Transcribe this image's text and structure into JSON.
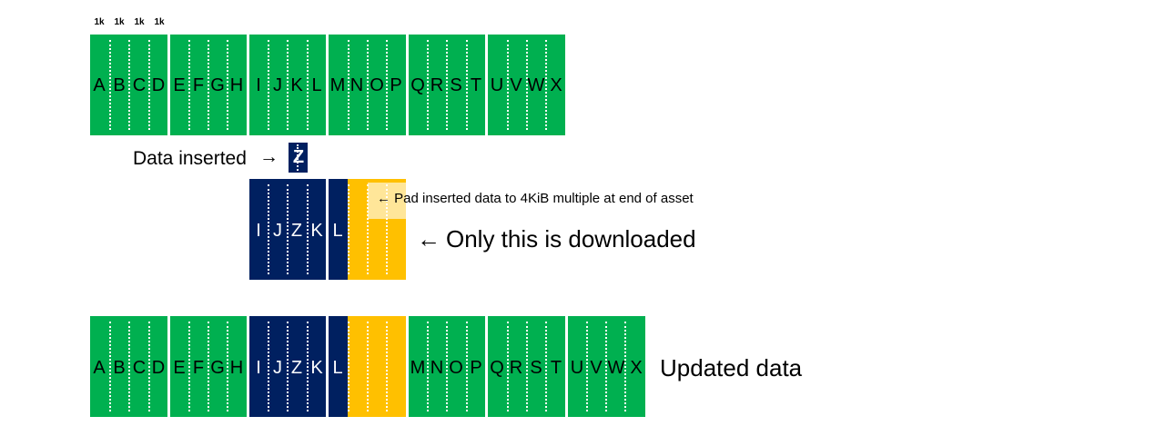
{
  "size_labels": [
    "1k",
    "1k",
    "1k",
    "1k"
  ],
  "row1": [
    "A",
    "B",
    "C",
    "D",
    "E",
    "F",
    "G",
    "H",
    "I",
    "J",
    "K",
    "L",
    "M",
    "N",
    "O",
    "P",
    "Q",
    "R",
    "S",
    "T",
    "U",
    "V",
    "W",
    "X"
  ],
  "inserted": {
    "label": "Data inserted",
    "arrow": "→",
    "value": "Z"
  },
  "row2": [
    "I",
    "J",
    "Z",
    "K",
    "L"
  ],
  "pad_note": "← Pad inserted data to 4KiB multiple at end of asset",
  "download_note": {
    "arrow": "←",
    "text": "Only this is downloaded"
  },
  "row3": [
    "A",
    "B",
    "C",
    "D",
    "E",
    "F",
    "G",
    "H",
    "I",
    "J",
    "Z",
    "K",
    "L",
    "M",
    "N",
    "O",
    "P",
    "Q",
    "R",
    "S",
    "T",
    "U",
    "V",
    "W",
    "X"
  ],
  "updated_label": "Updated data",
  "colors": {
    "green": "#00b050",
    "navy": "#002060",
    "gold": "#ffc000",
    "light_gold": "#ffe699"
  }
}
